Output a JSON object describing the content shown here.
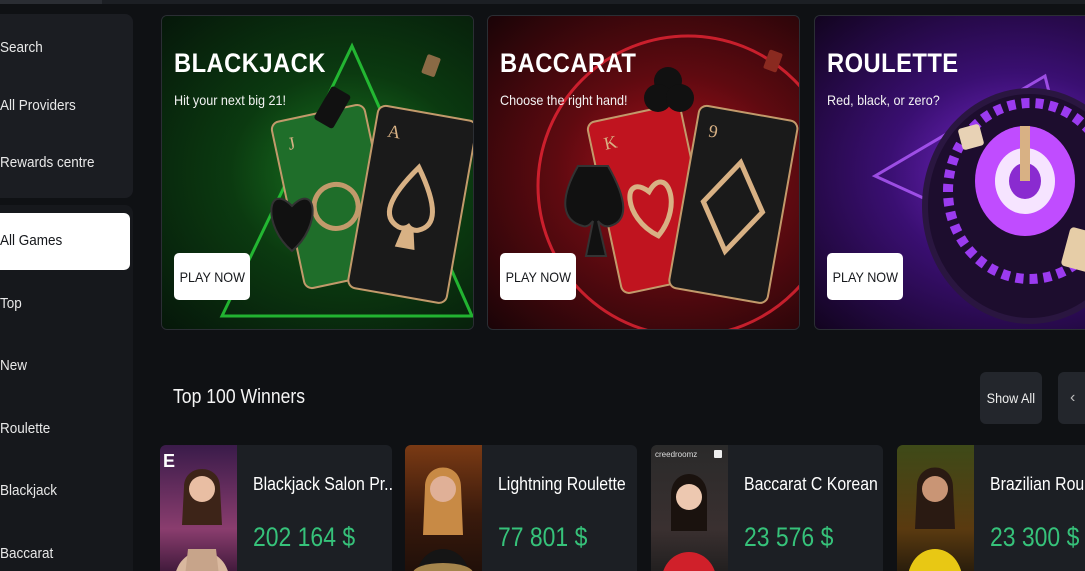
{
  "sidebar": {
    "links": [
      {
        "label": "Search"
      },
      {
        "label": "All Providers"
      },
      {
        "label": "Rewards centre"
      }
    ],
    "categories": [
      {
        "label": "All Games",
        "active": true
      },
      {
        "label": "Top"
      },
      {
        "label": "New"
      },
      {
        "label": "Roulette"
      },
      {
        "label": "Blackjack"
      },
      {
        "label": "Baccarat"
      }
    ]
  },
  "banners": [
    {
      "title": "BLACKJACK",
      "subtitle": "Hit your next big 21!",
      "button": "PLAY NOW",
      "color": "#0f6b1c"
    },
    {
      "title": "BACCARAT",
      "subtitle": "Choose the right hand!",
      "button": "PLAY NOW",
      "color": "#8a0c14"
    },
    {
      "title": "ROULETTE",
      "subtitle": "Red, black, or zero?",
      "button": "PLAY NOW",
      "color": "#5b1a9c"
    }
  ],
  "winners": {
    "title": "Top 100 Winners",
    "show_all": "Show All",
    "prev_icon": "‹",
    "items": [
      {
        "name": "Blackjack Salon Pr...",
        "amount": "202 164 $",
        "badge": "E"
      },
      {
        "name": "Lightning Roulette",
        "amount": "77 801 $"
      },
      {
        "name": "Baccarat C Korean",
        "amount": "23 576 $",
        "badge": "creedroomz"
      },
      {
        "name": "Brazilian Roulette",
        "amount": "23 300 $"
      }
    ]
  },
  "colors": {
    "accent_green": "#36c27a",
    "background": "#0f1114",
    "panel": "#1c1f24"
  }
}
